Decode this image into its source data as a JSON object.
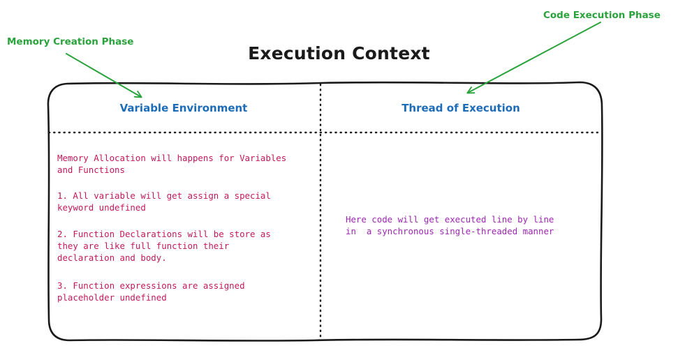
{
  "title": "Execution Context",
  "phases": {
    "memory": "Memory Creation Phase",
    "code": "Code Execution Phase"
  },
  "columns": {
    "left": {
      "heading": "Variable Environment",
      "paragraphs": [
        "Memory Allocation will happens for Variables\nand Functions",
        "1. All variable will get assign a special\nkeyword undefined",
        "2. Function Declarations will be store as\nthey are like full function their\ndeclaration and body.",
        "3. Function expressions are assigned\nplaceholder undefined"
      ]
    },
    "right": {
      "heading": "Thread of Execution",
      "text": "Here code will get executed line by line\nin  a synchronous single-threaded manner"
    }
  },
  "colors": {
    "phase_green": "#2aa33c",
    "heading_blue": "#1c6cb8",
    "left_text": "#c2185b",
    "right_text": "#9c27b0",
    "border": "#1a1a1a"
  },
  "icons": {
    "arrows": "arrow-icon"
  }
}
